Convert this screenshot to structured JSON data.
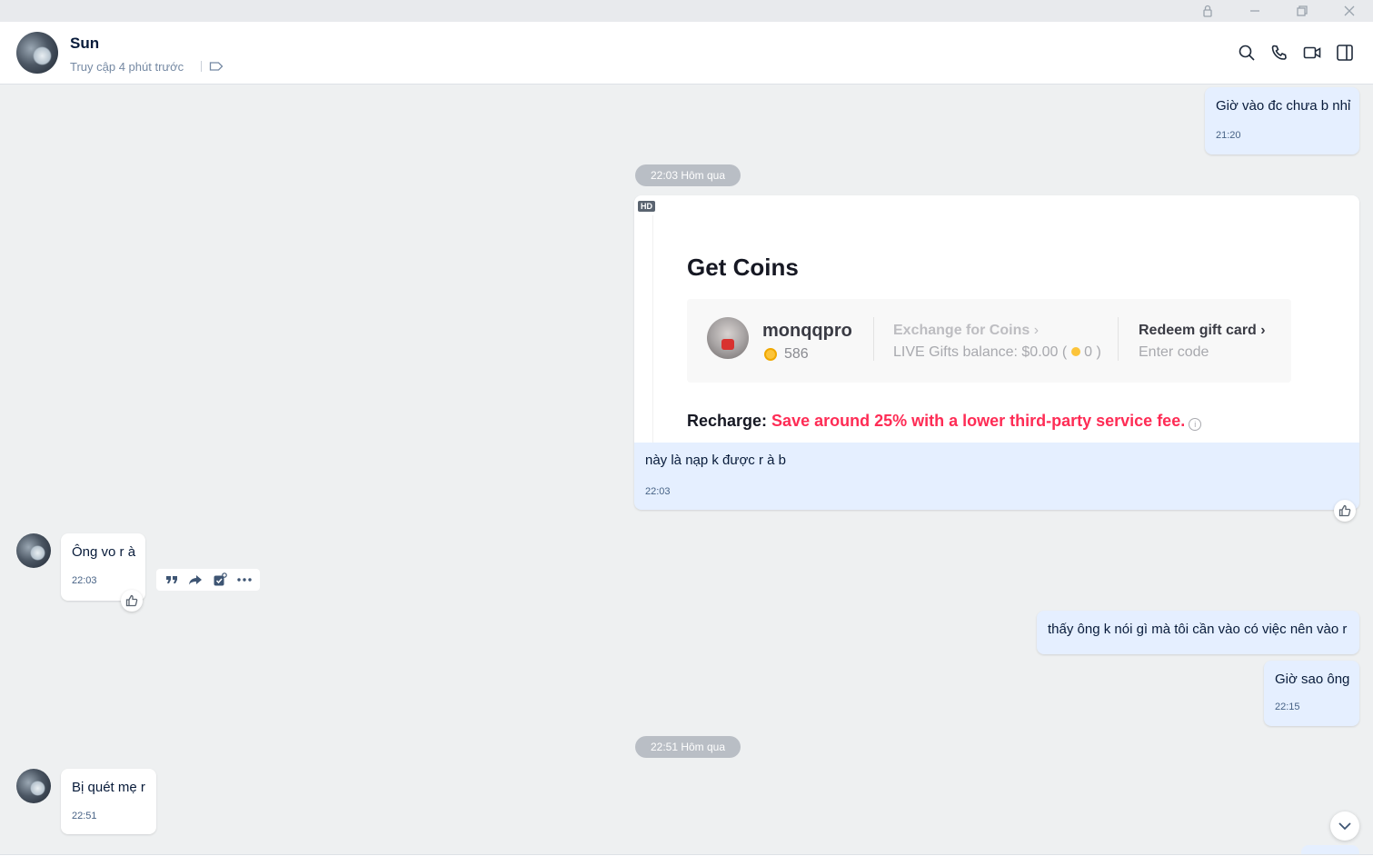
{
  "window": {
    "buttons": [
      "lock-icon",
      "minimize-icon",
      "restore-icon",
      "close-icon"
    ]
  },
  "header": {
    "name": "Sun",
    "status": "Truy cập 4 phút trước",
    "icons": [
      "tag-icon",
      "search-icon",
      "phone-icon",
      "video-icon",
      "panel-icon"
    ]
  },
  "messages": {
    "m1": {
      "text": "Giờ vào đc chưa b nhỉ",
      "time": "21:20"
    },
    "pill1": "22:03 Hôm qua",
    "card": {
      "hd": "HD",
      "title": "Get Coins",
      "username": "monqqpro",
      "coins": "586",
      "exchange_title": "Exchange for Coins",
      "exchange_balance_pre": "LIVE Gifts balance: $0.00 (",
      "exchange_balance_num": "0 )",
      "redeem_title": "Redeem gift card",
      "redeem_sub": "Enter code",
      "recharge_label": "Recharge:",
      "recharge_promo": "Save around 25% with a lower third-party service fee.",
      "caption": "này là nạp k được r à b",
      "time": "22:03"
    },
    "m3": {
      "text": "Ông vo r à",
      "time": "22:03"
    },
    "m4": {
      "text": "thấy ông k nói gì mà tôi cần vào có việc nên vào r"
    },
    "m5": {
      "text": "Giờ sao ông",
      "time": "22:15"
    },
    "pill2": "22:51 Hôm qua",
    "m6": {
      "text": "Bị quét mẹ r",
      "time": "22:51"
    }
  },
  "colors": {
    "outgoing_bubble": "#e5efff",
    "incoming_bubble": "#ffffff",
    "background": "#eef0f1",
    "promo_red": "#fe2c55"
  }
}
